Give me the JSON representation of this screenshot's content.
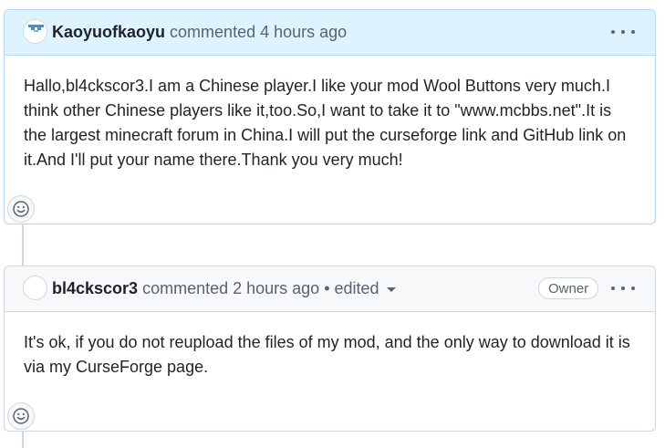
{
  "comments": [
    {
      "author": "Kaoyuofkaoyu",
      "meta": "commented 4 hours ago",
      "body": "Hallo,bl4ckscor3.I am a Chinese player.I like your mod Wool Buttons very much.I think other Chinese players like it,too.So,I want to take it to \"www.mcbbs.net\".It is the largest minecraft forum in China.I will put the curseforge link and GitHub link on it.And I'll put your name there.Thank you very much!"
    },
    {
      "author": "bl4ckscor3",
      "meta": "commented 2 hours ago",
      "edited": "• edited",
      "badge": "Owner",
      "body": "It's ok, if you do not reupload the files of my mod, and the only way to download it is via my CurseForge page."
    }
  ],
  "colors": {
    "highlight_header": "#ddf4ff",
    "border": "#d0d7de",
    "muted_text": "#59636e"
  },
  "icons": {
    "more": "kebab-horizontal-icon",
    "reaction": "smiley-icon"
  }
}
